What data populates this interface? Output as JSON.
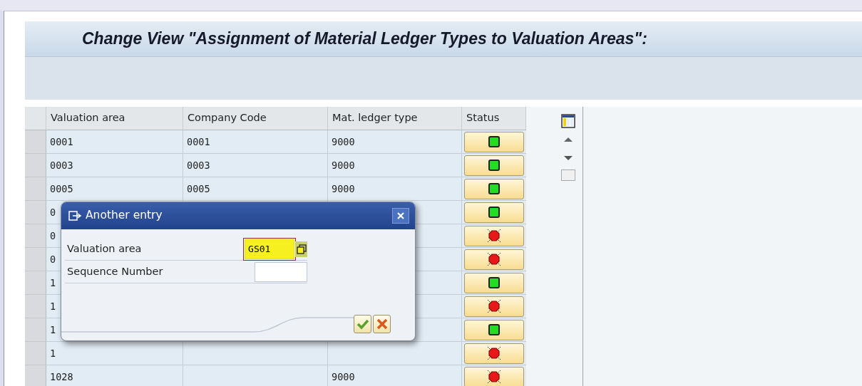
{
  "title": "Change View \"Assignment of Material Ledger Types to Valuation Areas\":",
  "table": {
    "columns": [
      "Valuation area",
      "Company Code",
      "Mat. ledger type",
      "Status"
    ],
    "rows": [
      {
        "valuation_area": "0001",
        "company_code": "0001",
        "ledger_type": "9000",
        "ok": true
      },
      {
        "valuation_area": "0003",
        "company_code": "0003",
        "ledger_type": "9000",
        "ok": true
      },
      {
        "valuation_area": "0005",
        "company_code": "0005",
        "ledger_type": "9000",
        "ok": true
      },
      {
        "valuation_area": "0",
        "ok": true
      },
      {
        "valuation_area": "0",
        "ok": false
      },
      {
        "valuation_area": "0",
        "ok": false
      },
      {
        "valuation_area": "1",
        "ok": true
      },
      {
        "valuation_area": "1",
        "ok": false
      },
      {
        "valuation_area": "1",
        "ok": true
      },
      {
        "valuation_area": "1",
        "ok": false
      },
      {
        "valuation_area": "1028",
        "ledger_type": "9000",
        "ok": false
      }
    ]
  },
  "dialog": {
    "title": "Another entry",
    "fields": [
      {
        "label": "Valuation area",
        "value": "GS01",
        "highlighted": true
      },
      {
        "label": "Sequence Number",
        "highlighted": false
      }
    ]
  }
}
